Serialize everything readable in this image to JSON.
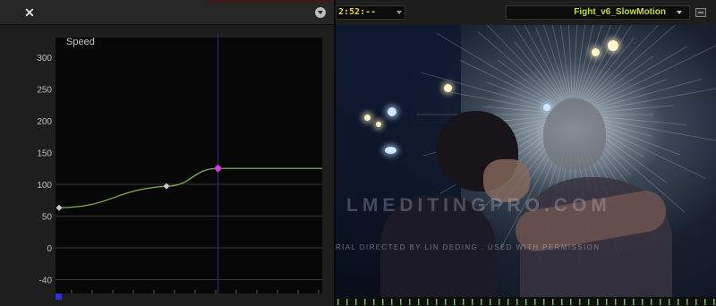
{
  "speed_panel": {
    "close_icon": "close-icon",
    "menu_icon": "chevron-down-circle-icon",
    "graph": {
      "title": "Speed",
      "y_ticks": [
        "300",
        "250",
        "200",
        "150",
        "100",
        "50",
        "0",
        "-40"
      ],
      "keyframes": [
        {
          "frame": 0,
          "speed": 63,
          "color": "#c9c9c9"
        },
        {
          "frame": 25,
          "speed": 97,
          "color": "#c9c9c9"
        },
        {
          "frame": 37,
          "speed": 125,
          "color": "#d63cd6"
        }
      ],
      "hold_speed": 125,
      "playhead_frame": 37,
      "colors": {
        "curve": "#7fb04a",
        "playhead": "#2a2a9a",
        "grid": "#4a4a4a",
        "selected_key": "#d63cd6"
      }
    }
  },
  "viewer_panel": {
    "timecode": "2:52:--",
    "clip_name": "Fight_v6_SlowMotion",
    "overlay_icon": "overlay-toggle-icon",
    "watermark": "LMEDITINGPRO.COM",
    "credit": "RIAL DIRECTED BY LIN DEDING . USED WITH PERMISSION"
  }
}
